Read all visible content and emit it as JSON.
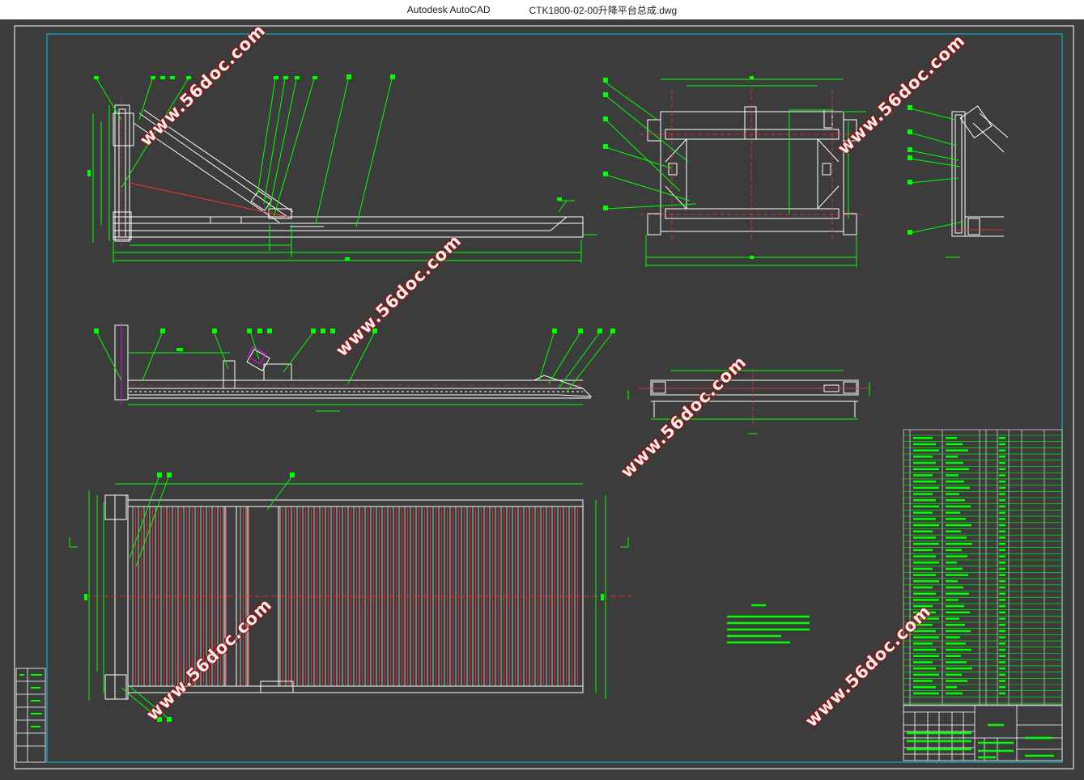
{
  "window": {
    "app_name": "Autodesk AutoCAD",
    "file_name": "CTK1800-02-00升降平台总成.dwg"
  },
  "watermark": {
    "text": "www.56doc.com"
  },
  "colors": {
    "background": "#3c3c3c",
    "white_line": "#ffffff",
    "green_line": "#00ff00",
    "red_line": "#ff3030",
    "cyan_frame": "#00c8e6",
    "magenta": "#ff00ff"
  },
  "drawing": {
    "views": [
      "side-elevation-view",
      "end-view-a",
      "detail-view-right",
      "section-view-b",
      "section-view-c",
      "plan-view",
      "technical-requirements",
      "bill-of-materials",
      "title-block"
    ]
  }
}
